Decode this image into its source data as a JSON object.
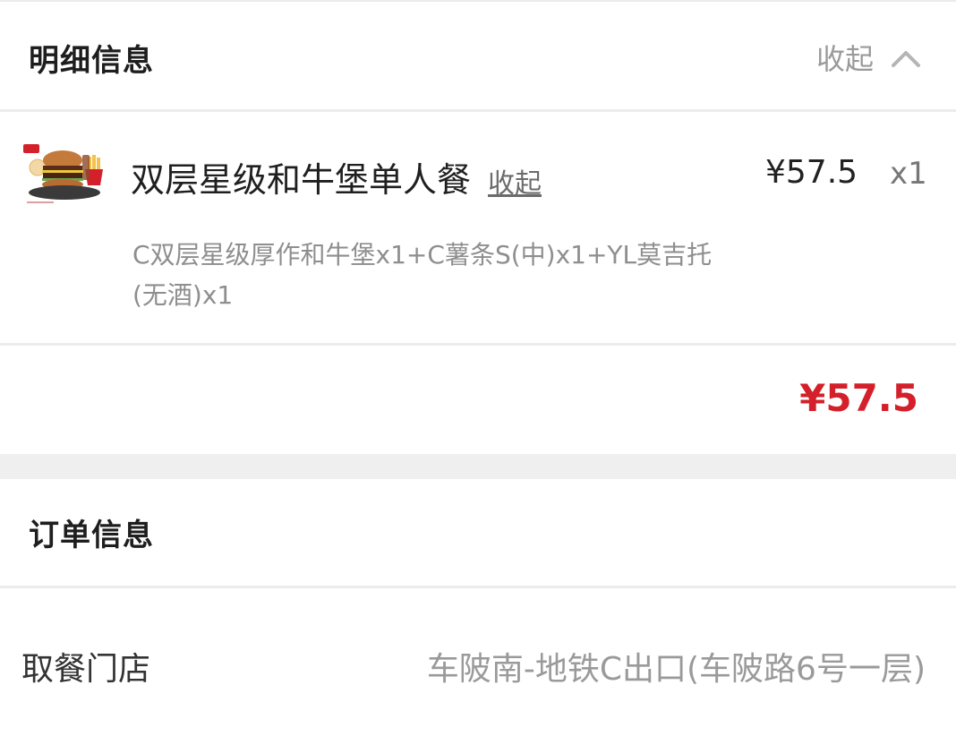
{
  "detail_section": {
    "title": "明细信息",
    "collapse_label": "收起"
  },
  "item": {
    "name": "双层星级和牛堡单人餐",
    "collapse_link": "收起",
    "price": "¥57.5",
    "quantity": "x1",
    "description": "C双层星级厚作和牛堡x1+C薯条S(中)x1+YL莫吉托(无酒)x1"
  },
  "total": {
    "amount": "¥57.5"
  },
  "order_section": {
    "title": "订单信息"
  },
  "pickup_store": {
    "label": "取餐门店",
    "value": "车陂南-地铁C出口(车陂路6号一层)"
  },
  "colors": {
    "accent_red": "#d4202a",
    "muted_text": "#9a9a9a",
    "divider": "#ececec"
  },
  "icons": {
    "collapse": "chevron-up-icon",
    "item_image": "burger-meal-thumbnail"
  }
}
